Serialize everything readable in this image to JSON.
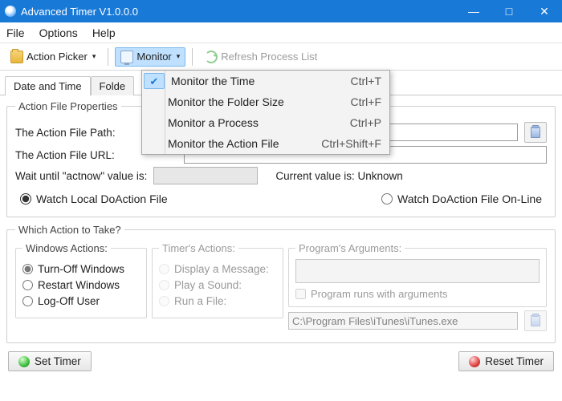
{
  "titlebar": {
    "title": "Advanced Timer V1.0.0.0"
  },
  "menubar": {
    "file": "File",
    "options": "Options",
    "help": "Help"
  },
  "toolbar": {
    "action_picker": "Action Picker",
    "monitor": "Monitor",
    "refresh": "Refresh Process List"
  },
  "monitor_menu": [
    {
      "label": "Monitor the Time",
      "shortcut": "Ctrl+T",
      "checked": true
    },
    {
      "label": "Monitor the Folder Size",
      "shortcut": "Ctrl+F",
      "checked": false
    },
    {
      "label": "Monitor a Process",
      "shortcut": "Ctrl+P",
      "checked": false
    },
    {
      "label": "Monitor the Action File",
      "shortcut": "Ctrl+Shift+F",
      "checked": false
    }
  ],
  "tabs": {
    "date_time": "Date and Time",
    "folder": "Folde"
  },
  "action_file": {
    "legend": "Action File Properties",
    "path_label": "The Action File Path:",
    "url_label": "The Action File URL:",
    "path_value": "",
    "url_value": "",
    "wait_label": "Wait until \"actnow\" value is:",
    "current_label": "Current value is:",
    "current_value": "Unknown",
    "watch_local": "Watch Local DoAction File",
    "watch_online": "Watch DoAction File On-Line"
  },
  "which_action": {
    "legend": "Which Action to Take?",
    "windows_legend": "Windows Actions:",
    "turn_off": "Turn-Off Windows",
    "restart": "Restart Windows",
    "logoff": "Log-Off User",
    "timers_legend": "Timer's Actions:",
    "display_msg": "Display a Message:",
    "play_sound": "Play a Sound:",
    "run_file": "Run a File:",
    "args_legend": "Program's Arguments:",
    "args_check": "Program runs with arguments",
    "run_path": "C:\\Program Files\\iTunes\\iTunes.exe"
  },
  "buttons": {
    "set": "Set Timer",
    "reset": "Reset Timer"
  }
}
